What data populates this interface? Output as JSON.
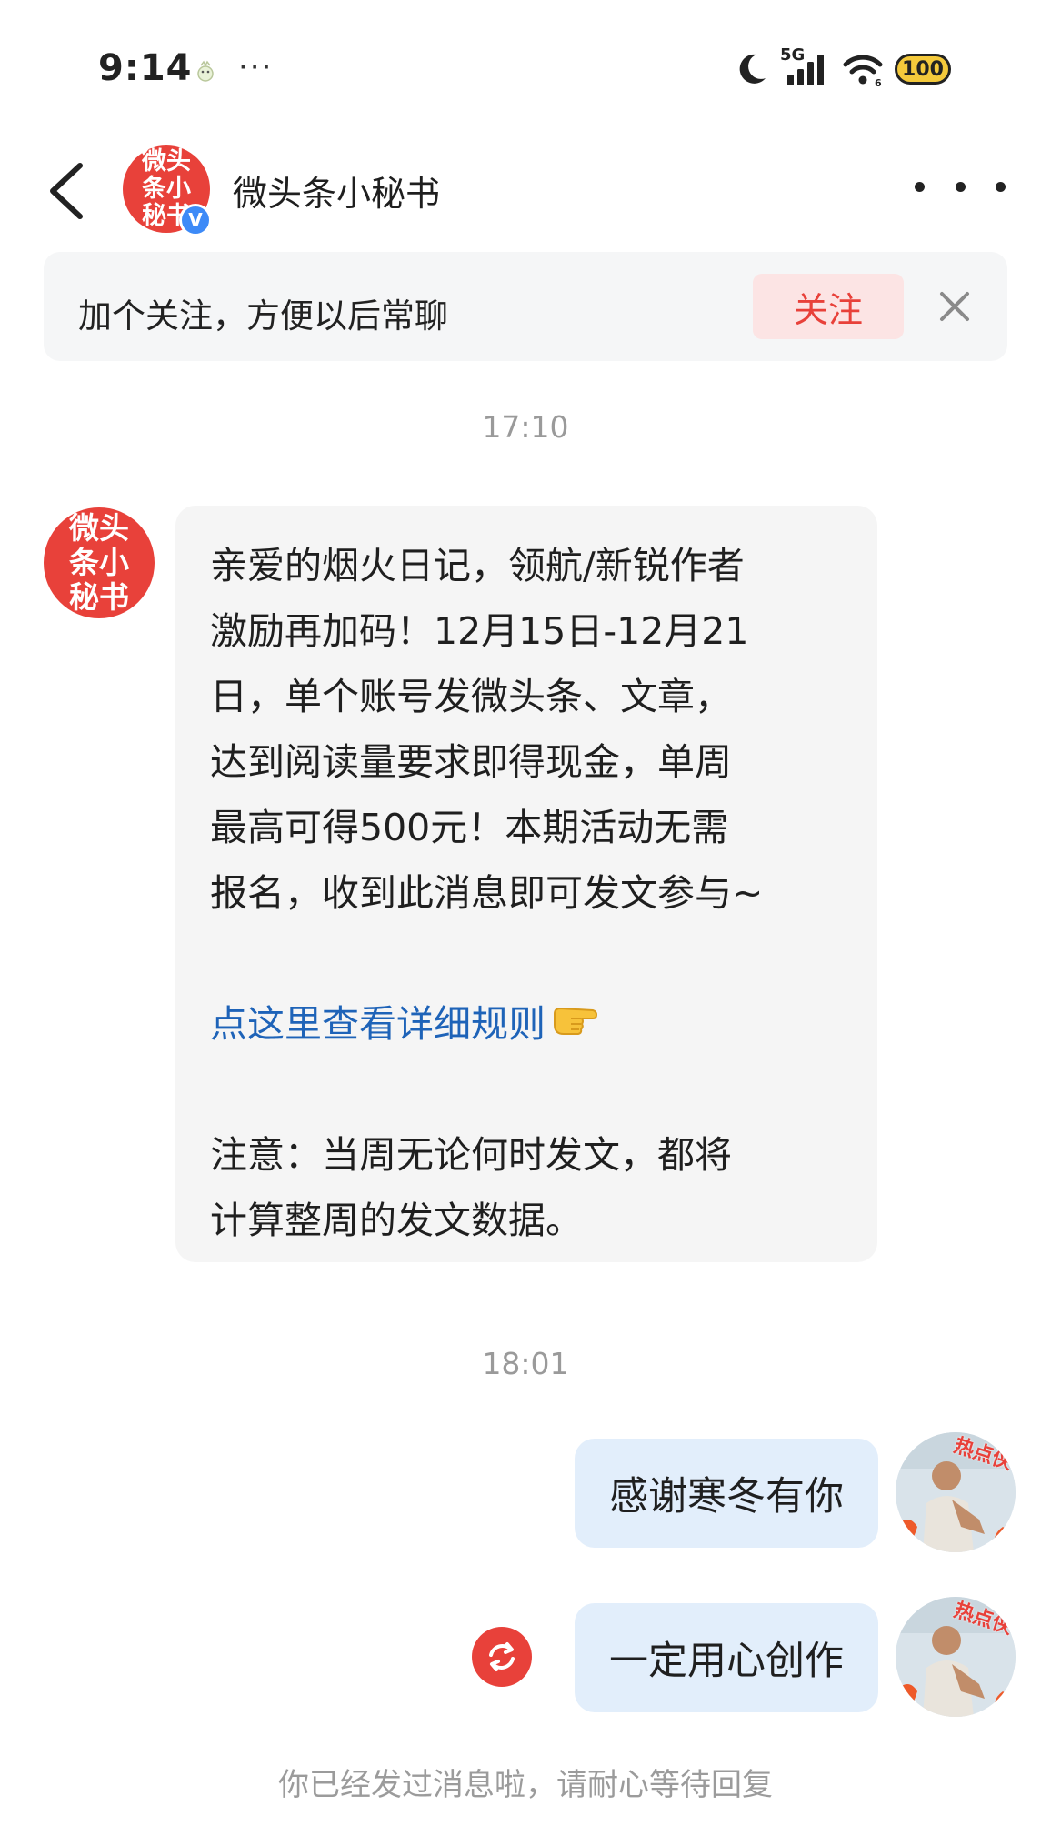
{
  "status_bar": {
    "time": "9:14",
    "dots": "···",
    "network_label": "5G",
    "battery": "100",
    "icons": [
      "moon-icon",
      "cellular-signal-icon",
      "wifi-icon",
      "battery-icon"
    ]
  },
  "header": {
    "title": "微头条小秘书",
    "avatar_text": "微头条小秘书",
    "verified_mark": "V",
    "icons": [
      "chevron-left-icon",
      "more-horizontal-icon"
    ]
  },
  "follow_banner": {
    "text": "加个关注，方便以后常聊",
    "follow_label": "关注",
    "icons": [
      "close-icon"
    ]
  },
  "messages": [
    {
      "timestamp": "17:10",
      "sender": "incoming",
      "avatar_text": "微头条小秘书",
      "lines": [
        "亲爱的烟火日记，领航/新锐作者",
        "激励再加码！12月15日-12月21",
        "日，单个账号发微头条、文章，",
        "达到阅读量要求即得现金，单周",
        "最高可得500元！本期活动无需",
        "报名，收到此消息即可发文参与~"
      ],
      "link_text": "点这里查看详细规则",
      "link_icon": "pointing-hand-icon",
      "note_lines": [
        "注意：当周无论何时发文，都将",
        "计算整周的发文数据。"
      ]
    },
    {
      "timestamp": "18:01",
      "sender": "outgoing",
      "text": "感谢寒冬有你"
    },
    {
      "sender": "outgoing",
      "text": "一定用心创作",
      "status_icon": "resend-icon"
    }
  ],
  "user_avatar": {
    "badge_text": "热点侠"
  },
  "footer_notice": "你已经发过消息啦，请耐心等待回复",
  "colors": {
    "brand_red": "#e8413a",
    "link_blue": "#1e63b8",
    "outgoing_bubble": "#e2eefb",
    "incoming_bubble": "#f5f5f5"
  }
}
